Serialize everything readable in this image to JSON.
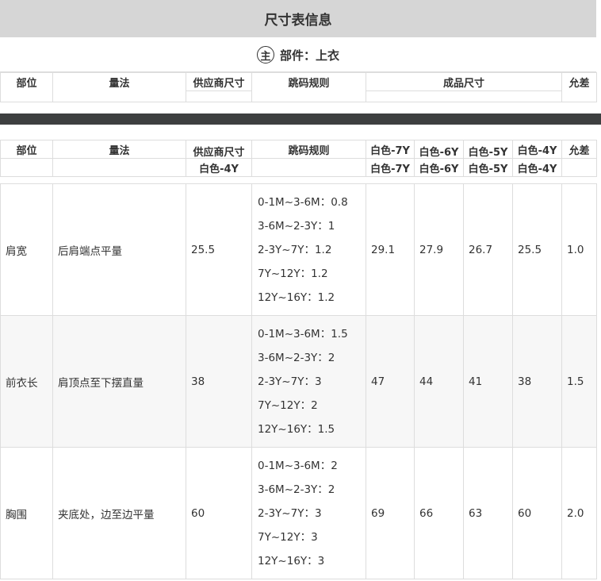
{
  "title": "尺寸表信息",
  "part": {
    "icon": "主",
    "label": "部件：上衣"
  },
  "headers": {
    "position": "部位",
    "method": "量法",
    "supplier_size": "供应商尺寸",
    "grading_rule": "跳码规则",
    "finished_size": "成品尺寸",
    "tolerance": "允差"
  },
  "size_columns": [
    "白色-7Y",
    "白色-6Y",
    "白色-5Y",
    "白色-4Y"
  ],
  "supplier_size_column": "白色-4Y",
  "rows": [
    {
      "position": "肩宽",
      "method": "后肩端点平量",
      "supplier": "25.5",
      "rules": [
        "0-1M~3-6M：0.8",
        "3-6M~2-3Y：1",
        "2-3Y~7Y：1.2",
        "7Y~12Y：1.2",
        "12Y~16Y：1.2"
      ],
      "sizes": [
        "29.1",
        "27.9",
        "26.7",
        "25.5"
      ],
      "tolerance": "1.0"
    },
    {
      "position": "前衣长",
      "method": "肩顶点至下摆直量",
      "supplier": "38",
      "rules": [
        "0-1M~3-6M：1.5",
        "3-6M~2-3Y：2",
        "2-3Y~7Y：3",
        "7Y~12Y：2",
        "12Y~16Y：1.5"
      ],
      "sizes": [
        "47",
        "44",
        "41",
        "38"
      ],
      "tolerance": "1.5"
    },
    {
      "position": "胸围",
      "method": "夹底处，边至边平量",
      "supplier": "60",
      "rules": [
        "0-1M~3-6M：2",
        "3-6M~2-3Y：2",
        "2-3Y~7Y：3",
        "7Y~12Y：3",
        "12Y~16Y：3"
      ],
      "sizes": [
        "69",
        "66",
        "63",
        "60"
      ],
      "tolerance": "2.0"
    }
  ]
}
